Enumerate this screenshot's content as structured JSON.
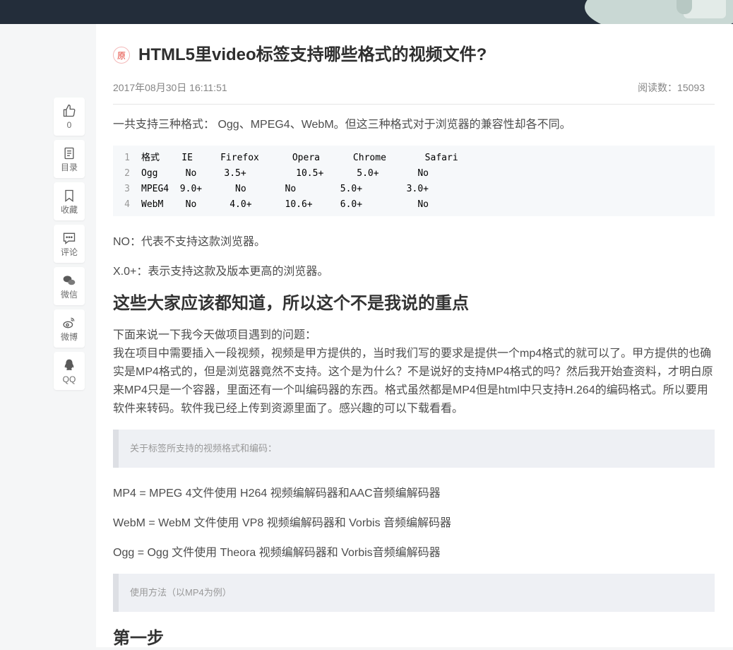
{
  "sidebar": {
    "like_count": "0",
    "toc_label": "目录",
    "collect_label": "收藏",
    "comment_label": "评论",
    "wechat_label": "微信",
    "weibo_label": "微博",
    "qq_label": "QQ"
  },
  "article": {
    "badge": "原",
    "title": "HTML5里video标签支持哪些格式的视频文件?",
    "date": "2017年08月30日 16:11:51",
    "reads": "阅读数：15093",
    "intro": "一共支持三种格式： Ogg、MPEG4、WebM。但这三种格式对于浏览器的兼容性却各不同。",
    "code_lines": [
      {
        "num": "1",
        "text": "格式    IE     Firefox      Opera      Chrome       Safari"
      },
      {
        "num": "2",
        "text": "Ogg     No     3.5+         10.5+      5.0+       No"
      },
      {
        "num": "3",
        "text": "MPEG4  9.0+      No       No        5.0+        3.0+"
      },
      {
        "num": "4",
        "text": "WebM    No      4.0+      10.6+     6.0+          No"
      }
    ],
    "note_no": "NO：代表不支持这款浏览器。",
    "note_x": "X.0+：表示支持这款及版本更高的浏览器。",
    "heading1": "这些大家应该都知道，所以这个不是我说的重点",
    "body_line1": "下面来说一下我今天做项目遇到的问题：",
    "body_para": "我在项目中需要插入一段视频，视频是甲方提供的，当时我们写的要求是提供一个mp4格式的就可以了。甲方提供的也确实是MP4格式的，但是浏览器竟然不支持。这个是为什么？不是说好的支持MP4格式的吗？然后我开始查资料，才明白原来MP4只是一个容器，里面还有一个叫编码器的东西。格式虽然都是MP4但是html中只支持H.264的编码格式。所以要用软件来转码。软件我已经上传到资源里面了。感兴趣的可以下载看看。",
    "quote1": "关于标签所支持的视频格式和编码：",
    "mp4_line": "MP4 = MPEG 4文件使用 H264 视频编解码器和AAC音频编解码器",
    "webm_line": "WebM = WebM 文件使用 VP8 视频编解码器和 Vorbis 音频编解码器",
    "ogg_line": "Ogg = Ogg 文件使用 Theora 视频编解码器和 Vorbis音频编解码器",
    "quote2": "使用方法（以MP4为例）",
    "heading2": "第一步"
  }
}
